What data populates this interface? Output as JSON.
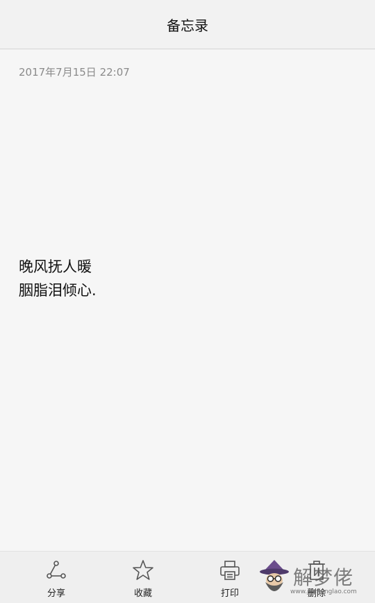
{
  "header": {
    "title": "备忘录"
  },
  "note": {
    "date": "2017年7月15日 22:07",
    "lines": [
      "晚风抚人暖",
      "胭脂泪倾心."
    ]
  },
  "toolbar": {
    "share": {
      "label": "分享",
      "icon": "share-icon"
    },
    "favorite": {
      "label": "收藏",
      "icon": "star-icon"
    },
    "print": {
      "label": "打印",
      "icon": "printer-icon"
    },
    "delete": {
      "label": "删除",
      "icon": "trash-icon"
    }
  },
  "watermark": {
    "text": "解梦佬",
    "url": "www.jiemenglao.com"
  }
}
